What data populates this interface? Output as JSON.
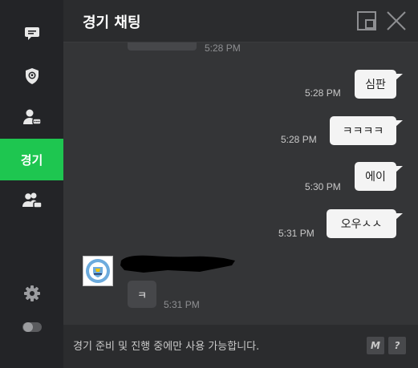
{
  "sidebar": {
    "active_label": "경기"
  },
  "header": {
    "title": "경기 채팅"
  },
  "chat": {
    "previous_time": "5:28 PM",
    "messages": [
      {
        "text": "심판",
        "time": "5:28 PM"
      },
      {
        "text": "ㅋㅋㅋㅋ",
        "time": "5:28 PM"
      },
      {
        "text": "에이",
        "time": "5:30 PM"
      },
      {
        "text": "오우ㅅㅅ",
        "time": "5:31 PM"
      }
    ],
    "incoming": {
      "text": "ㅋ",
      "time": "5:31 PM"
    }
  },
  "footer": {
    "notice": "경기 준비 및 진행 중에만 사용 가능합니다.",
    "m_label": "M",
    "help_label": "?"
  },
  "colors": {
    "accent": "#1ec650",
    "sidebar_bg": "#232427",
    "chat_bg": "#343537",
    "bubble_out": "#f4f4f4",
    "bubble_in": "#46474a"
  }
}
